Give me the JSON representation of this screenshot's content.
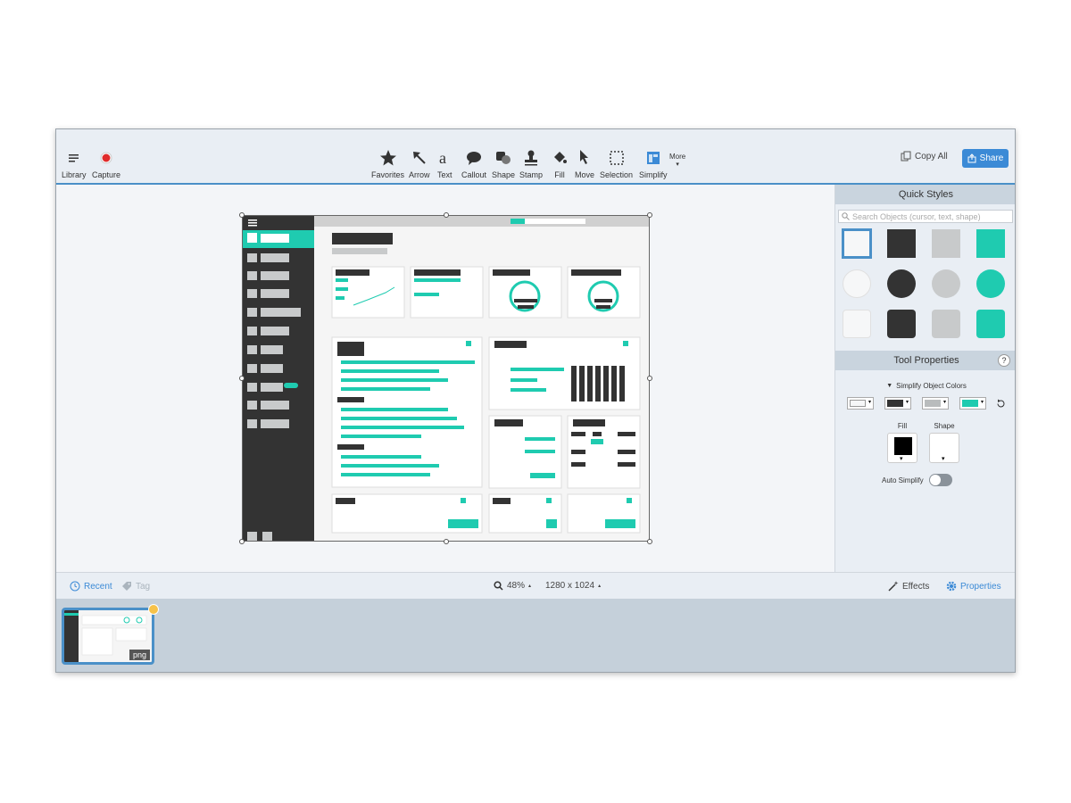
{
  "toolbar": {
    "library_label": "Library",
    "capture_label": "Capture",
    "tools": [
      {
        "label": "Favorites",
        "icon": "star-icon"
      },
      {
        "label": "Arrow",
        "icon": "arrow-icon"
      },
      {
        "label": "Text",
        "icon": "text-icon"
      },
      {
        "label": "Callout",
        "icon": "callout-icon"
      },
      {
        "label": "Shape",
        "icon": "shape-icon"
      },
      {
        "label": "Stamp",
        "icon": "stamp-icon"
      },
      {
        "label": "Fill",
        "icon": "fill-icon"
      },
      {
        "label": "Move",
        "icon": "move-icon"
      },
      {
        "label": "Selection",
        "icon": "selection-icon"
      },
      {
        "label": "Simplify",
        "icon": "simplify-icon"
      }
    ],
    "more_label": "More",
    "copy_all_label": "Copy All",
    "share_label": "Share"
  },
  "quick_styles": {
    "title": "Quick Styles",
    "search_placeholder": "Search Objects (cursor, text, shape)"
  },
  "tool_properties": {
    "title": "Tool Properties",
    "help_label": "?",
    "simplify_colors_label": "Simplify Object Colors",
    "fill_label": "Fill",
    "shape_label": "Shape",
    "auto_simplify_label": "Auto Simplify"
  },
  "statusbar": {
    "recent_label": "Recent",
    "tag_label": "Tag",
    "zoom": "48%",
    "dimensions": "1280 x 1024",
    "effects_label": "Effects",
    "properties_label": "Properties"
  },
  "tray": {
    "badge": "png"
  },
  "colors": {
    "accent": "#3b8ad6",
    "teal": "#1fcbb0",
    "dark": "#333333",
    "grey": "#c8cacb"
  }
}
